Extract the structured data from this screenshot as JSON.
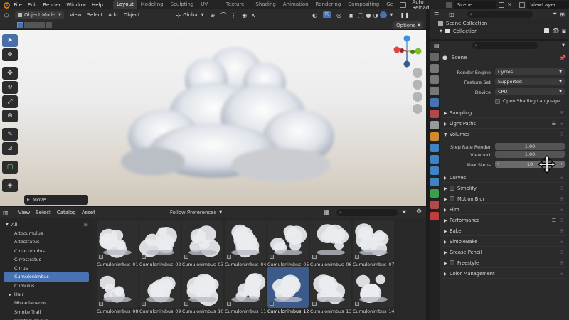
{
  "topbar": {
    "menus": [
      "File",
      "Edit",
      "Render",
      "Window",
      "Help"
    ],
    "workspaces": [
      "Layout",
      "Modeling",
      "Sculpting",
      "UV Editing",
      "Texture Paint",
      "Shading",
      "Animation",
      "Rendering",
      "Compositing",
      "Ge"
    ],
    "active_workspace": "Layout",
    "auto_reload": "Auto Reload",
    "scene": "Scene",
    "view_layer": "ViewLayer"
  },
  "viewport": {
    "mode": "Object Mode",
    "menus": [
      "View",
      "Select",
      "Add",
      "Object"
    ],
    "transform": "Global",
    "options": "Options",
    "last_op": "Move",
    "gizmo_axes": {
      "x": "X",
      "y": "Y",
      "z": "Z"
    }
  },
  "asset_browser": {
    "menus": [
      "View",
      "Select",
      "Catalog",
      "Asset"
    ],
    "import_method": "Follow Preferences",
    "catalog_all": "All",
    "catalogs": [
      "Altocumulus",
      "Altostratus",
      "Cirrocumulus",
      "Cirrostratus",
      "Cirrus",
      "Cumulonimbus",
      "Cumulus",
      "Hair",
      "Miscellaneous",
      "Smoke Trail",
      "Stratocumulus"
    ],
    "selected_catalog": "Cumulonimbus",
    "assets": [
      "Cumulonimbus_01",
      "Cumulonimbus_02",
      "Cumulonimbus_03",
      "Cumulonimbus_04",
      "Cumulonimbus_05",
      "Cumulonimbus_06",
      "Cumulonimbus_07",
      "Cumulonimbus_08",
      "Cumulonimbus_09",
      "Cumulonimbus_10",
      "Cumulonimbus_11",
      "Cumulonimbus_12",
      "Cumulonimbus_13",
      "Cumulonimbus_14"
    ],
    "selected_asset": "Cumulonimbus_12"
  },
  "outliner": {
    "scene_collection": "Scene Collection",
    "collection": "Collection"
  },
  "properties": {
    "context": "Scene",
    "render_engine_label": "Render Engine",
    "render_engine": "Cycles",
    "feature_set_label": "Feature Set",
    "feature_set": "Supported",
    "device_label": "Device",
    "device": "CPU",
    "osl_label": "Open Shading Language",
    "panels_top": [
      "Sampling",
      "Light Paths"
    ],
    "volumes": {
      "title": "Volumes",
      "step_rate_render_label": "Step Rate Render",
      "step_rate_render": "1.00",
      "viewport_label": "Viewport",
      "viewport": "1.00",
      "max_steps_label": "Max Steps",
      "max_steps": "10"
    },
    "panels_bottom": [
      "Curves",
      "Simplify",
      "Motion Blur",
      "Film",
      "Performance",
      "Bake",
      "SimpleBake",
      "Grease Pencil",
      "Freestyle",
      "Color Management"
    ]
  },
  "colors": {
    "accent": "#4772b3",
    "gizmo_x": "#e04444",
    "gizmo_y": "#7cbf2a",
    "gizmo_z": "#3d8fe0"
  }
}
